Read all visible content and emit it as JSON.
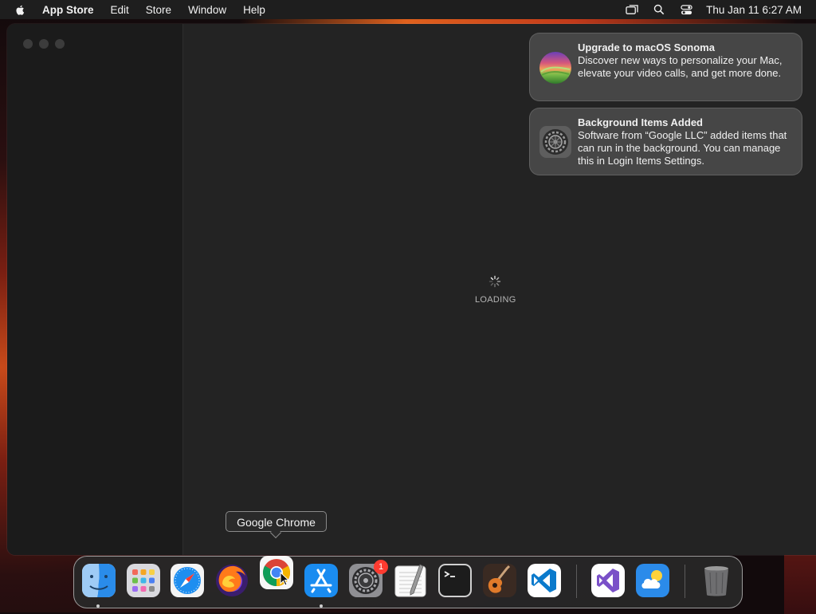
{
  "menubar": {
    "app_name": "App Store",
    "menus": [
      "Edit",
      "Store",
      "Window",
      "Help"
    ],
    "clock": "Thu Jan 11  6:27 AM"
  },
  "main": {
    "loading_label": "LOADING"
  },
  "notifications": [
    {
      "title": "Upgrade to macOS Sonoma",
      "body": "Discover new ways to personalize your Mac, elevate your video calls, and get more done."
    },
    {
      "title": "Background Items Added",
      "body": "Software from “Google LLC” added items that can run in the background. You can manage this in Login Items Settings."
    }
  ],
  "dock": {
    "tooltip": "Google Chrome",
    "items": [
      {
        "icon": "finder-icon",
        "running": true
      },
      {
        "icon": "launchpad-icon",
        "running": false
      },
      {
        "icon": "safari-icon",
        "running": false
      },
      {
        "icon": "firefox-icon",
        "running": false
      },
      {
        "icon": "chrome-icon",
        "running": false
      },
      {
        "icon": "app-store-icon",
        "running": true
      },
      {
        "icon": "system-settings-icon",
        "running": false,
        "badge": "1"
      },
      {
        "icon": "textedit-icon",
        "running": false
      },
      {
        "icon": "terminal-icon",
        "running": false
      },
      {
        "icon": "garageband-icon",
        "running": false
      },
      {
        "icon": "vscode-icon",
        "running": false
      },
      {
        "icon": "visual-studio-icon",
        "running": false
      },
      {
        "icon": "weather-icon",
        "running": false
      },
      {
        "icon": "trash-icon",
        "running": false
      }
    ]
  },
  "colors": {
    "badge": "#ff3b30",
    "menubar": "#1e1e1e",
    "window": "#232323"
  }
}
